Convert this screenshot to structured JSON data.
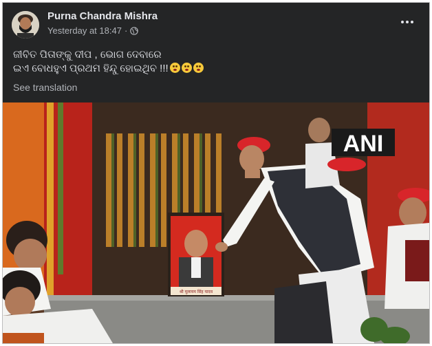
{
  "post": {
    "author": "Purna Chandra Mishra",
    "timestamp": "Yesterday at 18:47",
    "separator": "·",
    "privacy_icon": "globe-icon",
    "text_line1": "ଜୀବିତ ପିତାଙ୍କୁ ଦୀପ , ଭୋଗ ଦେବାରେ",
    "text_line2": "ଇଏ ବୋଧହୁଏ ପ୍ରଥମ ହିନ୍ଦୁ ହୋଇଥିବ !!!",
    "emojis": [
      "flushed-face",
      "flushed-face",
      "flushed-face"
    ],
    "see_translation": "See translation",
    "more_icon": "more-horizontal-icon"
  },
  "photo": {
    "watermark": "ANI",
    "portrait_caption": "श्री मुलायम सिंह यादव"
  },
  "colors": {
    "background": "#242526",
    "text_primary": "#e4e6eb",
    "text_secondary": "#b0b3b8"
  }
}
